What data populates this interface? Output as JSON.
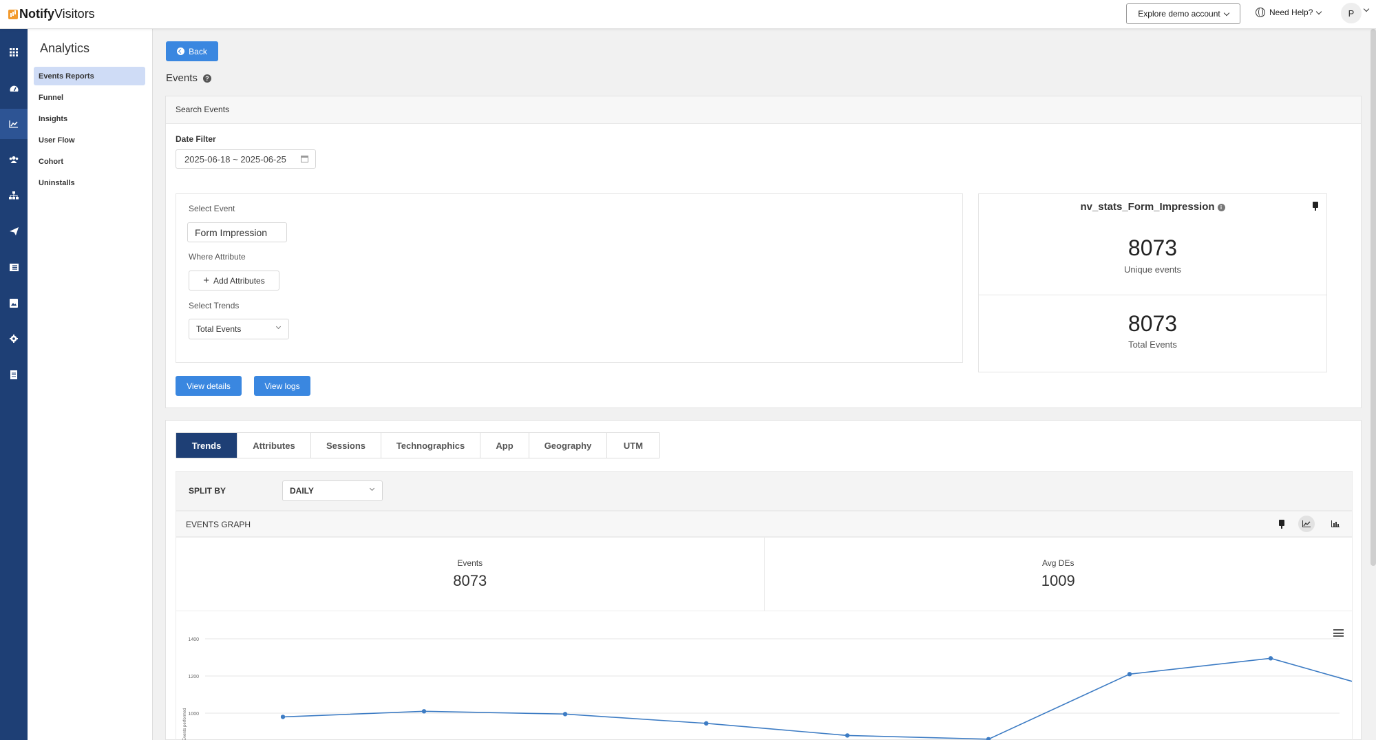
{
  "app": {
    "brand_bold": "Notify",
    "brand_light": "Visitors"
  },
  "topbar": {
    "explore_label": "Explore demo account",
    "help_label": "Need Help?",
    "avatar_initial": "P"
  },
  "rail": {
    "items": [
      "apps-icon",
      "dashboard-icon",
      "analytics-icon",
      "users-icon",
      "sitemap-icon",
      "send-icon",
      "list-icon",
      "image-icon",
      "settings-icon",
      "document-icon"
    ],
    "active_index": 2
  },
  "subnav": {
    "title": "Analytics",
    "items": [
      "Events Reports",
      "Funnel",
      "Insights",
      "User Flow",
      "Cohort",
      "Uninstalls"
    ],
    "active_index": 0
  },
  "main": {
    "back_label": "Back",
    "page_title": "Events",
    "search_panel": {
      "header": "Search Events",
      "date_filter_label": "Date Filter",
      "date_range": "2025-06-18 ~ 2025-06-25",
      "select_event_label": "Select Event",
      "select_event_value": "Form Impression",
      "where_attribute_label": "Where Attribute",
      "add_attributes_label": "Add Attributes",
      "select_trends_label": "Select Trends",
      "select_trends_value": "Total Events",
      "view_details_label": "View details",
      "view_logs_label": "View logs"
    },
    "stats": {
      "event_name": "nv_stats_Form_Impression",
      "unique_value": "8073",
      "unique_label": "Unique events",
      "total_value": "8073",
      "total_label": "Total Events"
    },
    "tabs": [
      "Trends",
      "Attributes",
      "Sessions",
      "Technographics",
      "App",
      "Geography",
      "UTM"
    ],
    "active_tab": 0,
    "split_by_label": "SPLIT BY",
    "split_by_value": "DAILY",
    "events_graph_label": "EVENTS GRAPH",
    "summary": {
      "events_label": "Events",
      "events_value": "8073",
      "avg_label": "Avg DEs",
      "avg_value": "1009"
    }
  },
  "chart_data": {
    "type": "line",
    "ylabel": "Events performed",
    "y_ticks": [
      1000,
      1200,
      1400
    ],
    "ylim": [
      1000,
      1400
    ],
    "line_color": "#3d7cc4",
    "series": [
      {
        "values": [
          980,
          1010,
          995,
          945,
          880,
          860,
          1210,
          1295,
          1080
        ]
      }
    ]
  },
  "colors": {
    "rail": "#1e3f75",
    "accent": "#3a87e0",
    "tab_active": "#1e3f75"
  }
}
